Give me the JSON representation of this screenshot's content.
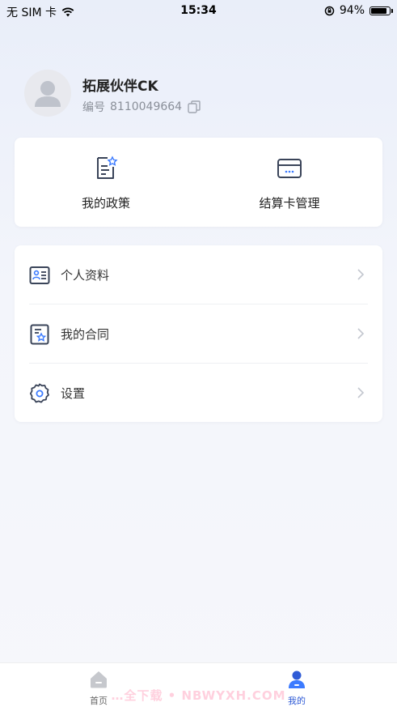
{
  "status_bar": {
    "carrier": "无 SIM 卡",
    "time": "15:34",
    "battery_percent": "94%",
    "battery_level": 0.94
  },
  "profile": {
    "name": "拓展伙伴CK",
    "id_label": "编号",
    "id_value": "8110049664"
  },
  "quick_actions": [
    {
      "label": "我的政策",
      "icon": "policy-doc-star-icon"
    },
    {
      "label": "结算卡管理",
      "icon": "bank-card-icon"
    }
  ],
  "menu": [
    {
      "label": "个人资料",
      "icon": "id-card-icon"
    },
    {
      "label": "我的合同",
      "icon": "contract-star-icon"
    },
    {
      "label": "设置",
      "icon": "gear-icon"
    }
  ],
  "tabs": [
    {
      "label": "首页",
      "icon": "home-icon",
      "active": false
    },
    {
      "label": "我的",
      "icon": "person-icon",
      "active": true
    }
  ],
  "watermark": "…全下载 • NBWYXH.COM",
  "colors": {
    "accent": "#2f5bd6",
    "icon_stroke": "#3a4459",
    "icon_accent": "#3c7bff"
  }
}
